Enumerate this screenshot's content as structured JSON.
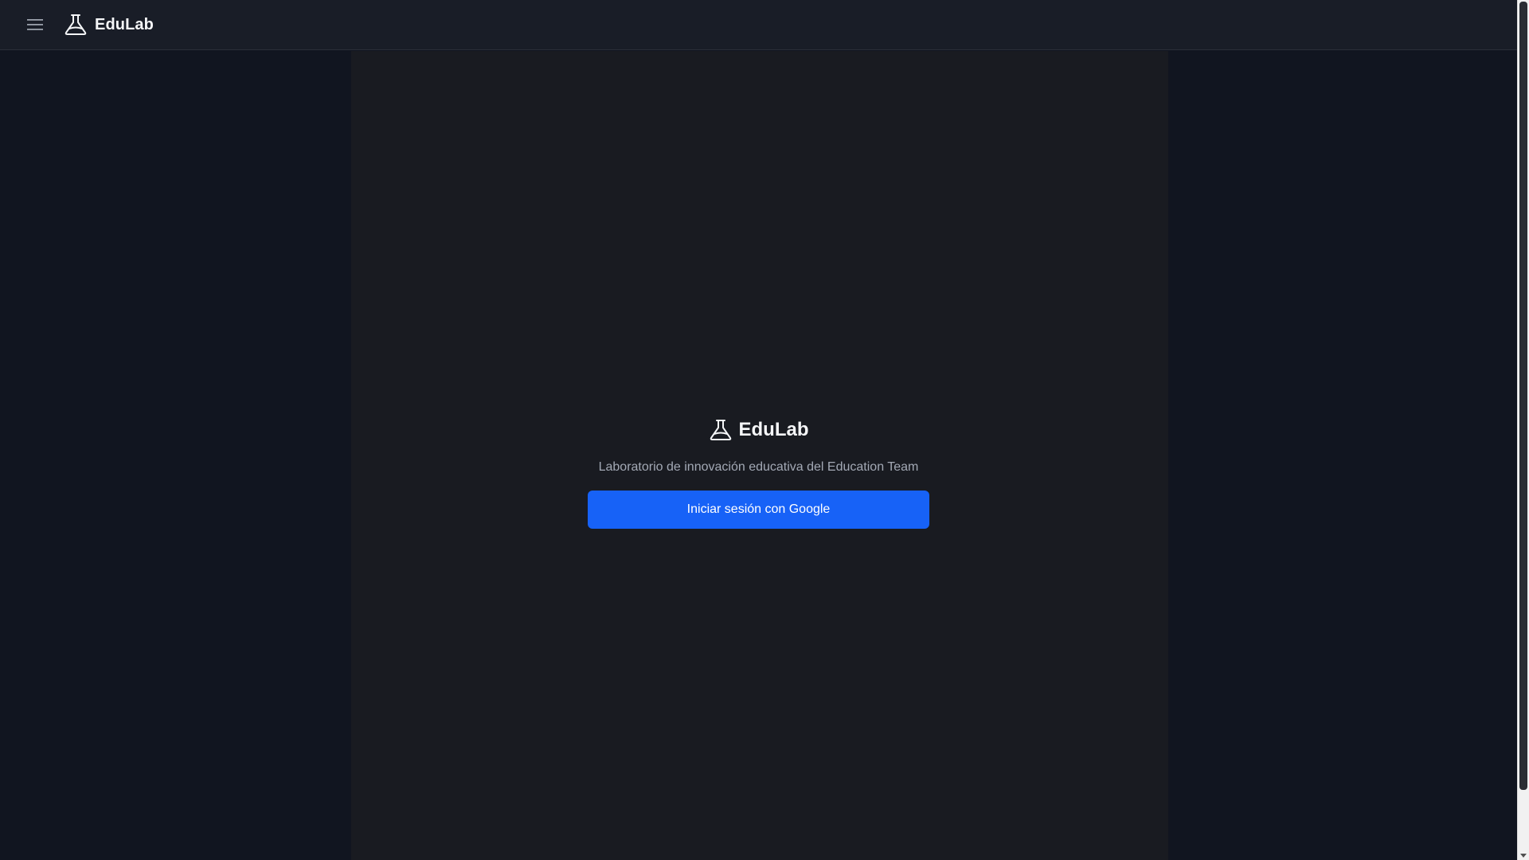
{
  "header": {
    "brand_name": "EduLab",
    "menu_icon": "hamburger-menu-icon",
    "brand_icon": "flask-icon"
  },
  "login": {
    "brand_name": "EduLab",
    "brand_icon": "flask-icon",
    "tagline": "Laboratorio de innovación educativa del Education Team",
    "google_button_label": "Iniciar sesión con Google"
  },
  "colors": {
    "accent": "#1762f7",
    "header_bg": "#191d27",
    "page_bg": "#111520",
    "panel_bg": "#191b21",
    "text_primary": "#f5f6f8",
    "text_secondary": "#a3a9b5"
  }
}
